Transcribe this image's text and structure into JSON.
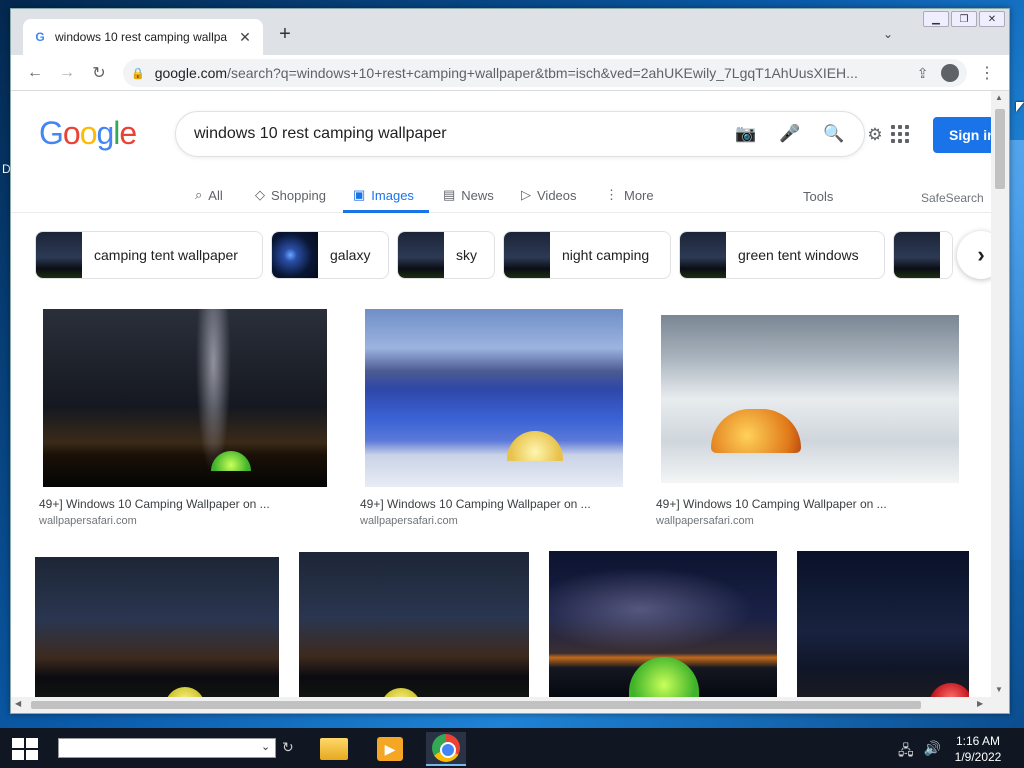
{
  "browser": {
    "tab_title": "windows 10 rest camping wallpa",
    "tab_favicon": "G",
    "tab_close": "✕",
    "new_tab": "+",
    "tab_menu": "⌄",
    "url_host": "google.com",
    "url_rest": "/search?q=windows+10+rest+camping+wallpaper&tbm=isch&ved=2ahUKEwily_7LgqT1AhUusXIEH..."
  },
  "page": {
    "logo": [
      "G",
      "o",
      "o",
      "g",
      "l",
      "e"
    ],
    "search_query": "windows 10 rest camping wallpaper",
    "sign_in": "Sign in",
    "nav_tabs": [
      {
        "label": "All",
        "icon": "search-icon"
      },
      {
        "label": "Shopping",
        "icon": "tag-icon"
      },
      {
        "label": "Images",
        "icon": "image-icon"
      },
      {
        "label": "News",
        "icon": "news-icon"
      },
      {
        "label": "Videos",
        "icon": "play-icon"
      },
      {
        "label": "More",
        "icon": "more-vertical-icon"
      }
    ],
    "active_tab": "Images",
    "tools": "Tools",
    "safesearch": "SafeSearch",
    "chips": [
      "camping tent wallpaper",
      "galaxy",
      "sky",
      "night camping",
      "green tent windows"
    ],
    "results_row1": [
      {
        "title": "49+] Windows 10 Camping Wallpaper on ...",
        "source": "wallpapersafari.com"
      },
      {
        "title": "49+] Windows 10 Camping Wallpaper on ...",
        "source": "wallpapersafari.com"
      },
      {
        "title": "49+] Windows 10 Camping Wallpaper on ...",
        "source": "wallpapersafari.com"
      }
    ]
  },
  "taskbar": {
    "time": "1:16 AM",
    "date": "1/9/2022",
    "active_app": "Google Chrome"
  },
  "desktop": {
    "edge_letter": "D"
  },
  "colors": {
    "accent": "#1a73e8",
    "tab_strip": "#dee1e6",
    "taskbar": "#101622"
  }
}
